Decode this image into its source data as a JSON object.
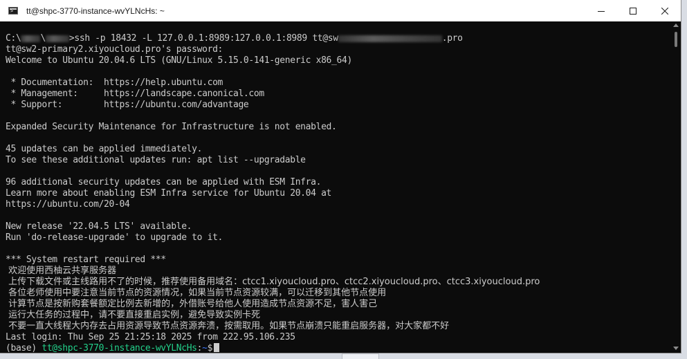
{
  "window": {
    "title": "tt@shpc-3770-instance-wvYLNcHs: ~"
  },
  "terminal": {
    "ssh": {
      "prefix": "C:\\",
      "middle": "\\",
      "command": ">ssh -p 18432 -L 127.0.0.1:8989:127.0.0.1:8989 tt@sw",
      "suffix": ".pro"
    },
    "lines_a": [
      "tt@sw2-primary2.xiyoucloud.pro's password:",
      "Welcome to Ubuntu 20.04.6 LTS (GNU/Linux 5.15.0-141-generic x86_64)",
      "",
      " * Documentation:  https://help.ubuntu.com",
      " * Management:     https://landscape.canonical.com",
      " * Support:        https://ubuntu.com/advantage",
      "",
      "Expanded Security Maintenance for Infrastructure is not enabled.",
      "",
      "45 updates can be applied immediately.",
      "To see these additional updates run: apt list --upgradable",
      "",
      "96 additional security updates can be applied with ESM Infra.",
      "Learn more about enabling ESM Infra service for Ubuntu 20.04 at",
      "https://ubuntu.com/20-04",
      "",
      "New release '22.04.5 LTS' available.",
      "Run 'do-release-upgrade' to upgrade to it.",
      "",
      "*** System restart required ***"
    ],
    "lines_cjk": [
      " 欢迎使用西柚云共享服务器",
      " 上传下载文件或主线路用不了的时候，推荐使用备用域名：ctcc1.xiyoucloud.pro、ctcc2.xiyoucloud.pro、ctcc3.xiyoucloud.pro",
      " 各位老师使用中要注意当前节点的资源情况，如果当前节点资源较满，可以迁移到其他节点使用",
      " 计算节点是按新购套餐额定比例去新增的，外借账号给他人使用造成节点资源不足，害人害己",
      " 运行大任务的过程中，请不要直接重启实例，避免导致实例卡死",
      " 不要一直大线程大内存去占用资源导致节点资源奔溃，按需取用。如果节点崩溃只能重启服务器，对大家都不好"
    ],
    "last_login": "Last login: Thu Sep 25 21:25:18 2025 from 222.95.106.235",
    "prompt": {
      "env": "(base) ",
      "user_host": "tt@shpc-3770-instance-wvYLNcHs",
      "colon": ":",
      "path": "~",
      "symbol": "$"
    }
  },
  "colors": {
    "terminal_bg": "#0c0c0c",
    "terminal_fg": "#cccccc",
    "prompt_user": "#23d18b",
    "prompt_path": "#3b78ff"
  }
}
